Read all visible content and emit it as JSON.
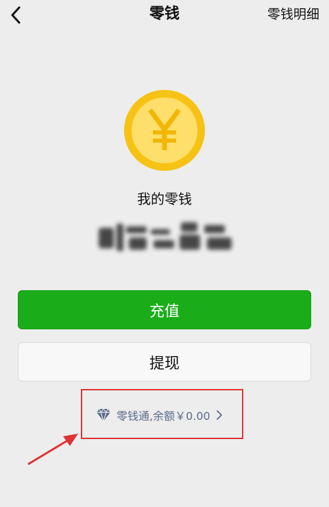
{
  "nav": {
    "title": "零钱",
    "right_link": "零钱明细"
  },
  "wallet": {
    "label": "我的零钱",
    "balance_obscured": true,
    "coin_symbol": "¥"
  },
  "actions": {
    "recharge_label": "充值",
    "withdraw_label": "提现"
  },
  "lingqiantong": {
    "text": "零钱通,余额￥0.00"
  },
  "colors": {
    "primary_green": "#1aad19",
    "coin_yellow": "#f6c315",
    "coin_inner": "#ffdf6b",
    "link_blue_gray": "#5b6b8c",
    "annotation_red": "#e03232"
  }
}
